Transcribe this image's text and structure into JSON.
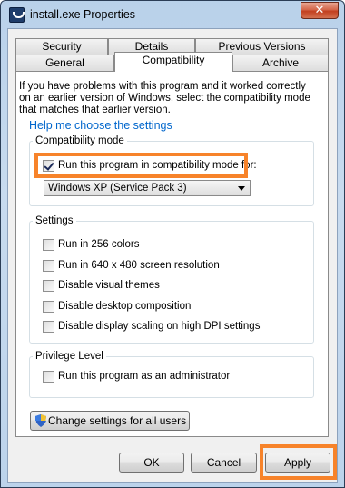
{
  "window": {
    "title": "install.exe Properties",
    "close_label": "✕"
  },
  "tabs": {
    "row1": [
      "Security",
      "Details",
      "Previous Versions"
    ],
    "row2": [
      "General",
      "Compatibility",
      "Archive"
    ]
  },
  "intro": "If you have problems with this program and it worked correctly on an earlier version of Windows, select the compatibility mode that matches that earlier version.",
  "help_link": "Help me choose the settings",
  "compat_mode": {
    "group_label": "Compatibility mode",
    "checkbox_label": "Run this program in compatibility mode for:",
    "checked": true,
    "selected_os": "Windows XP (Service Pack 3)"
  },
  "settings": {
    "group_label": "Settings",
    "options": [
      "Run in 256 colors",
      "Run in 640 x 480 screen resolution",
      "Disable visual themes",
      "Disable desktop composition",
      "Disable display scaling on high DPI settings"
    ]
  },
  "privilege": {
    "group_label": "Privilege Level",
    "checkbox_label": "Run this program as an administrator"
  },
  "change_all_label": "Change settings for all users",
  "buttons": {
    "ok": "OK",
    "cancel": "Cancel",
    "apply": "Apply"
  },
  "highlight_color": "#f7832a"
}
